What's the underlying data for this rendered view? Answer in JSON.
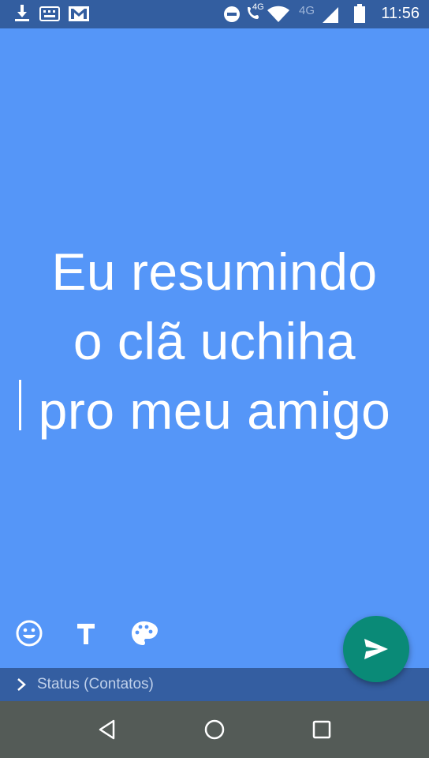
{
  "status_bar": {
    "time": "11:56",
    "network_labels": [
      "4G",
      "4G"
    ],
    "icons": [
      "download-icon",
      "keyboard-icon",
      "gmail-icon",
      "do-not-disturb-icon",
      "wifi-call-icon",
      "wifi-icon",
      "signal-icon",
      "battery-icon"
    ]
  },
  "status_editor": {
    "text_lines": [
      "Eu resumindo",
      "o clã uchiha",
      "pro meu amigo"
    ],
    "background_color": "#5596F8",
    "tools": [
      "emoji-icon",
      "text-style-icon",
      "palette-icon"
    ]
  },
  "recipient_bar": {
    "label": "Status (Contatos)"
  },
  "send_button": {
    "color": "#0A8A77",
    "icon": "send-icon"
  },
  "nav_bar": {
    "buttons": [
      "back-icon",
      "home-icon",
      "recents-icon"
    ]
  }
}
